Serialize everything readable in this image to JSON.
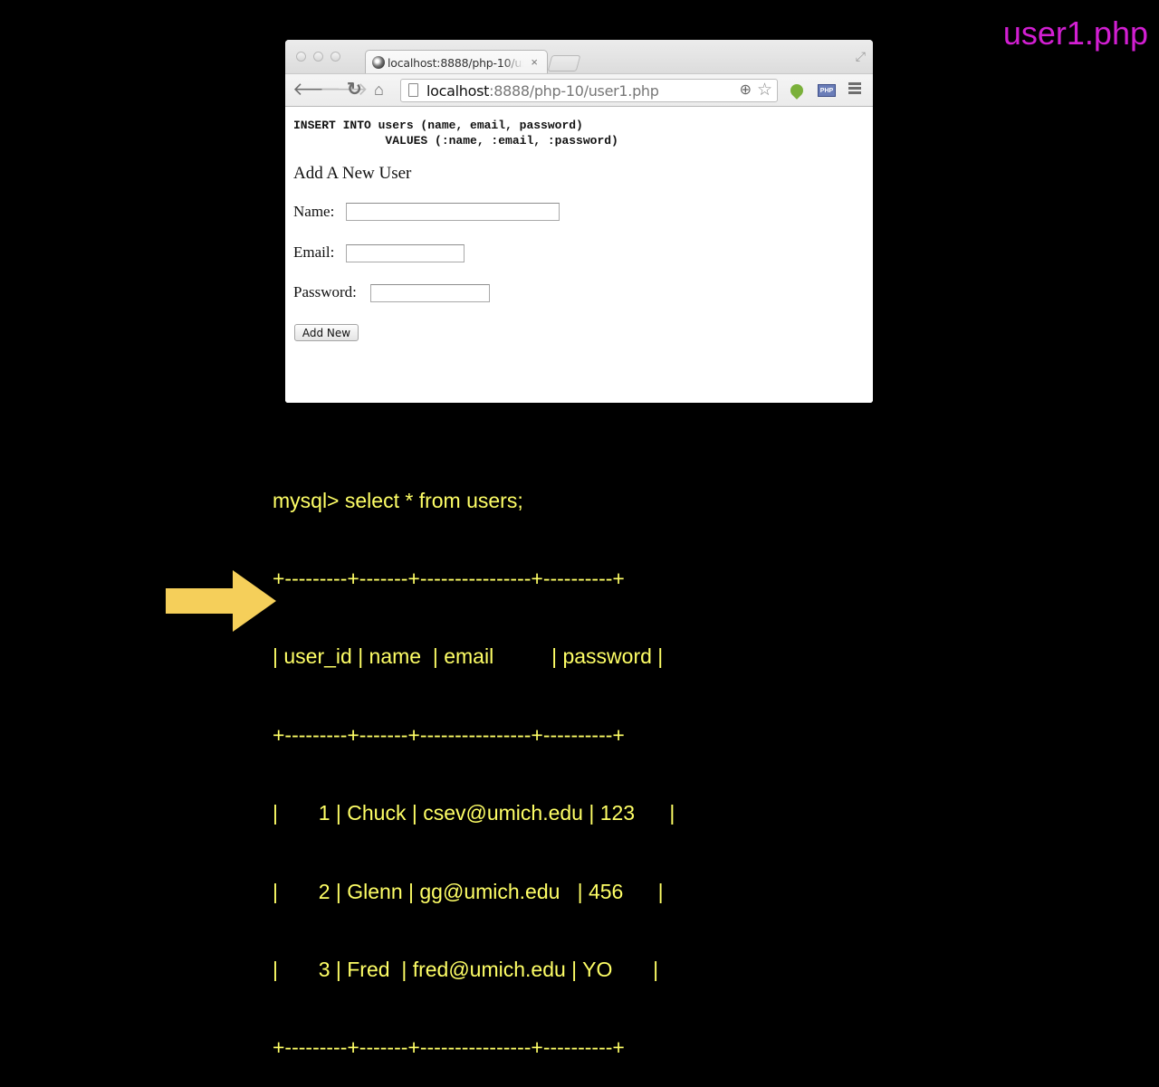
{
  "slide": {
    "title": "user1.php"
  },
  "browser": {
    "tab": {
      "title": "localhost:8888/php-10/us"
    },
    "omnibox": {
      "host": "localhost",
      "rest": ":8888/php-10/user1.php"
    },
    "icons": {
      "back": "arrow-left-icon",
      "forward": "arrow-right-icon",
      "reload": "reload-icon",
      "home": "home-icon",
      "page": "page-icon",
      "zoom": "zoom-icon",
      "bookmark": "star-icon",
      "extension1": "evernote-icon",
      "extension2": "php-icon",
      "menu": "hamburger-menu-icon",
      "fullscreen": "fullscreen-icon",
      "close_tab": "×"
    },
    "page": {
      "sql_line1": "INSERT INTO users (name, email, password)",
      "sql_line2": "             VALUES (:name, :email, :password)",
      "heading": "Add A New User",
      "form": {
        "name_label": "Name:",
        "name_value": "",
        "email_label": "Email:",
        "email_value": "",
        "password_label": "Password:",
        "password_value": "",
        "submit_label": "Add New"
      }
    }
  },
  "terminal": {
    "command": "mysql> select * from users;",
    "border": "+---------+-------+----------------+----------+",
    "header": "| user_id | name  | email          | password |",
    "columns": [
      "user_id",
      "name",
      "email",
      "password"
    ],
    "rows": [
      {
        "user_id": "1",
        "name": "Chuck",
        "email": "csev@umich.edu",
        "password": "123"
      },
      {
        "user_id": "2",
        "name": "Glenn",
        "email": "gg@umich.edu",
        "password": "456"
      },
      {
        "user_id": "3",
        "name": "Fred",
        "email": "fred@umich.edu",
        "password": "YO"
      }
    ],
    "row_lines": [
      "|       1 | Chuck | csev@umich.edu | 123      |",
      "|       2 | Glenn | gg@umich.edu   | 456      |",
      "|       3 | Fred  | fred@umich.edu | YO       |"
    ],
    "highlighted_row": 3
  },
  "colors": {
    "title": "#d21fd2",
    "terminal_text": "#ffff66",
    "arrow": "#f5cf5a",
    "background": "#000000"
  }
}
